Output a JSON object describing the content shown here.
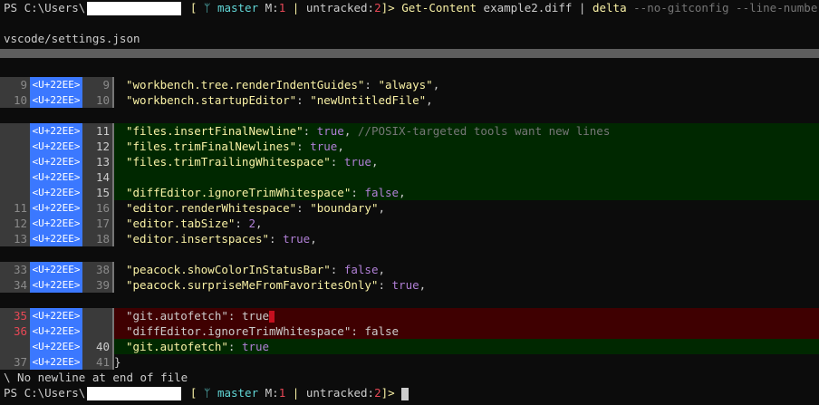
{
  "prompt_top": {
    "ps": "PS C:\\Users\\",
    "branch_open": "[",
    "branch_icon": "ᛘ",
    "branch": "master",
    "modified_label": "M:",
    "modified_count": "1",
    "pipe": "|",
    "untracked_label": "untracked:",
    "untracked_count": "2",
    "branch_close": "]>",
    "cmd": "Get-Content",
    "arg": "example2.diff",
    "pipe2": "|",
    "delta": "delta",
    "flags": "--no-gitconfig --line-numbers"
  },
  "file_title": "vscode/settings.json",
  "diff_tag": "<U+22EE>",
  "hunks": [
    {
      "lines": [
        {
          "type": "ctx",
          "old": "9",
          "new": "9",
          "key": "\"workbench.tree.renderIndentGuides\"",
          "sep": ": ",
          "val": "\"always\"",
          "valtype": "s",
          "tail": ","
        },
        {
          "type": "ctx",
          "old": "10",
          "new": "10",
          "key": "\"workbench.startupEditor\"",
          "sep": ": ",
          "val": "\"newUntitledFile\"",
          "valtype": "s",
          "tail": ","
        }
      ]
    },
    {
      "lines": [
        {
          "type": "plus",
          "old": "",
          "new": "11",
          "key": "\"files.insertFinalNewline\"",
          "sep": ": ",
          "val": "true",
          "valtype": "kw",
          "tail": ", ",
          "comment": "//POSIX-targeted tools want new lines"
        },
        {
          "type": "plus",
          "old": "",
          "new": "12",
          "key": "\"files.trimFinalNewlines\"",
          "sep": ": ",
          "val": "true",
          "valtype": "kw",
          "tail": ","
        },
        {
          "type": "plus",
          "old": "",
          "new": "13",
          "key": "\"files.trimTrailingWhitespace\"",
          "sep": ": ",
          "val": "true",
          "valtype": "kw",
          "tail": ","
        },
        {
          "type": "plus",
          "old": "",
          "new": "14",
          "key": "",
          "sep": "",
          "val": "",
          "valtype": "",
          "tail": ""
        },
        {
          "type": "plus",
          "old": "",
          "new": "15",
          "key": "\"diffEditor.ignoreTrimWhitespace\"",
          "sep": ": ",
          "val": "false",
          "valtype": "kw",
          "tail": ","
        },
        {
          "type": "ctx",
          "old": "11",
          "new": "16",
          "key": "\"editor.renderWhitespace\"",
          "sep": ": ",
          "val": "\"boundary\"",
          "valtype": "s",
          "tail": ","
        },
        {
          "type": "ctx",
          "old": "12",
          "new": "17",
          "key": "\"editor.tabSize\"",
          "sep": ": ",
          "val": "2",
          "valtype": "num",
          "tail": ","
        },
        {
          "type": "ctx",
          "old": "13",
          "new": "18",
          "key": "\"editor.insertspaces\"",
          "sep": ": ",
          "val": "true",
          "valtype": "kw",
          "tail": ","
        }
      ]
    },
    {
      "lines": [
        {
          "type": "ctx",
          "old": "33",
          "new": "38",
          "key": "\"peacock.showColorInStatusBar\"",
          "sep": ": ",
          "val": "false",
          "valtype": "kw",
          "tail": ","
        },
        {
          "type": "ctx",
          "old": "34",
          "new": "39",
          "key": "\"peacock.surpriseMeFromFavoritesOnly\"",
          "sep": ": ",
          "val": "true",
          "valtype": "kw",
          "tail": ","
        }
      ]
    },
    {
      "lines": [
        {
          "type": "minus",
          "old": "35",
          "new": "",
          "key": "\"git.autofetch\"",
          "sep": ": ",
          "val": "true",
          "valtype": "plain",
          "tail": "",
          "bad": true
        },
        {
          "type": "minus",
          "old": "36",
          "new": "",
          "key": "\"diffEditor.ignoreTrimWhitespace\"",
          "sep": ": ",
          "val": "false",
          "valtype": "plain",
          "tail": ""
        },
        {
          "type": "plus",
          "old": "",
          "new": "40",
          "key": "\"git.autofetch\"",
          "sep": ": ",
          "val": "true",
          "valtype": "kw",
          "tail": ""
        },
        {
          "type": "ctx",
          "old": "37",
          "new": "41",
          "key": "}",
          "sep": "",
          "val": "",
          "valtype": "",
          "tail": "",
          "brace": true
        }
      ]
    }
  ],
  "no_newline": "\\ No newline at end of file",
  "prompt_bottom": {
    "ps": "PS C:\\Users\\",
    "branch_open": "[",
    "branch_icon": "ᛘ",
    "branch": "master",
    "modified_label": "M:",
    "modified_count": "1",
    "pipe": "|",
    "untracked_label": "untracked:",
    "untracked_count": "2",
    "branch_close": "]>"
  },
  "colors": {
    "background": "#0c0c0c",
    "minus_bg": "#3f0001",
    "plus_bg": "#002800",
    "tag_bg": "#3b78ff",
    "rule": "#5e5e5e"
  }
}
